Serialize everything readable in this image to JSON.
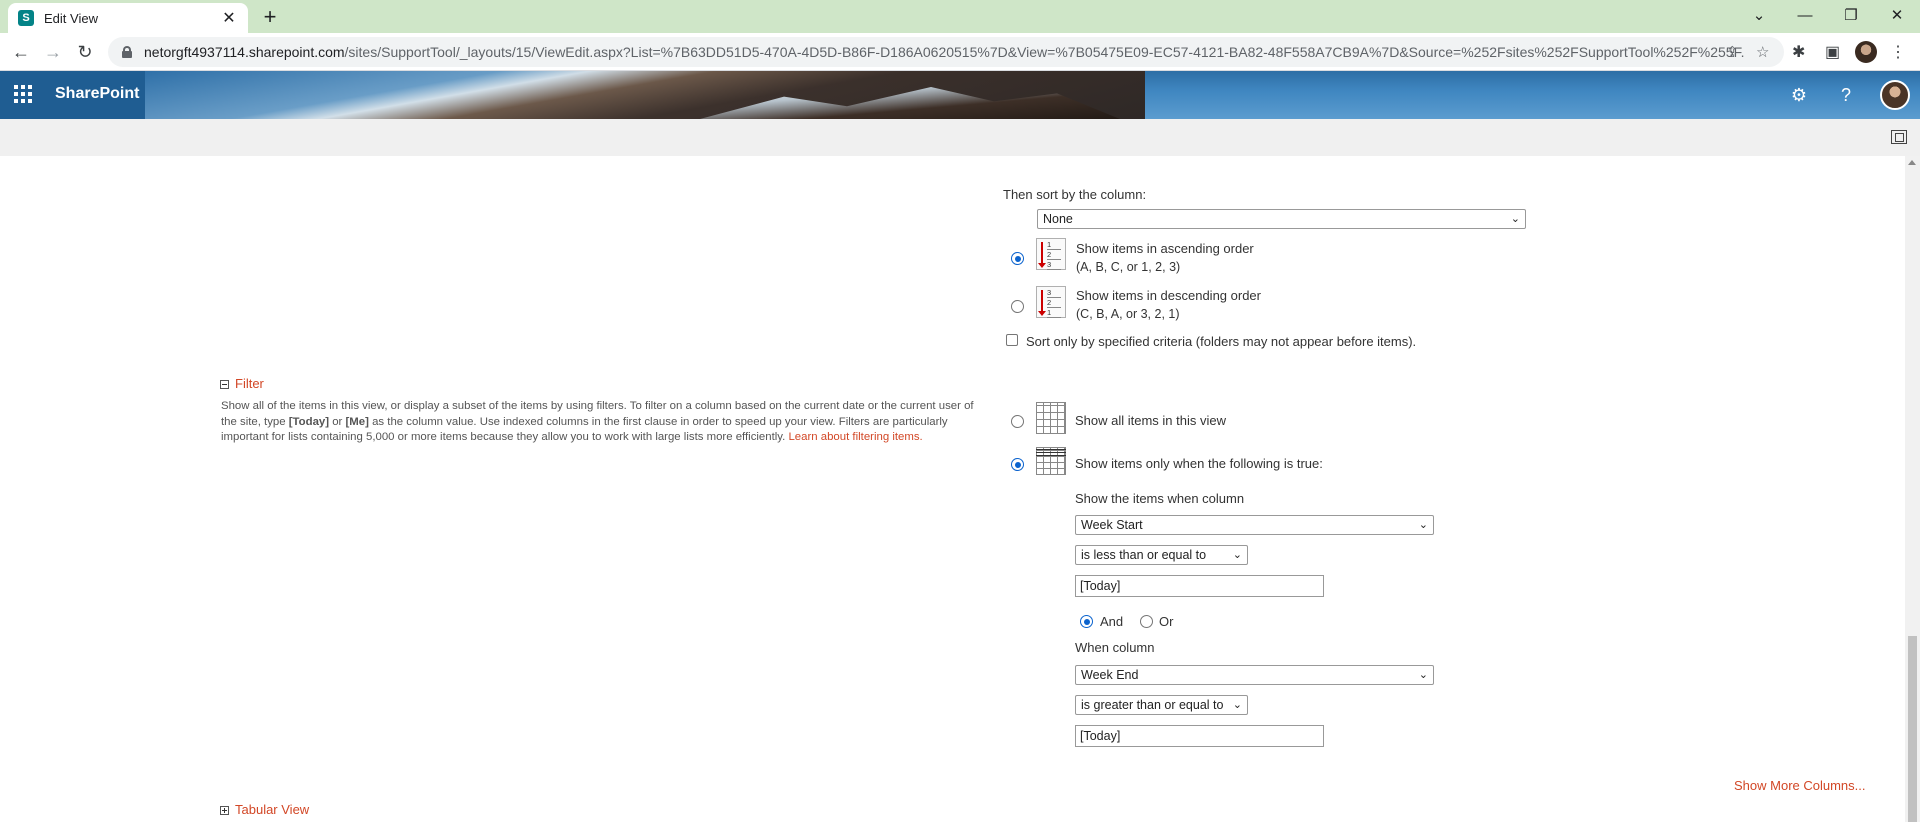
{
  "browser": {
    "tab_title": "Edit View",
    "favicon_letter": "S",
    "url_host": "netorgft4937114.sharepoint.com",
    "url_path": "/sites/SupportTool/_layouts/15/ViewEdit.aspx?List=%7B63DD51D5-470A-4D5D-B86F-D186A0620515%7D&View=%7B05475E09-EC57-4121-BA82-48F558A7CB9A%7D&Source=%252Fsites%252FSupportTool%252F%255F..."
  },
  "suite": {
    "app_name": "SharePoint"
  },
  "sort": {
    "then_sort_label": "Then sort by the column:",
    "column_value": "None",
    "ascending_label": "Show items in ascending order",
    "ascending_sub": "(A, B, C, or 1, 2, 3)",
    "descending_label": "Show items in descending order",
    "descending_sub": "(C, B, A, or 3, 2, 1)",
    "ascending_selected": true,
    "criteria_label": "Sort only by specified criteria (folders may not appear before items).",
    "asc_digits": [
      "1",
      "2",
      "3"
    ],
    "desc_digits": [
      "3",
      "2",
      "1"
    ]
  },
  "filter": {
    "title": "Filter",
    "desc_part1": "Show all of the items in this view, or display a subset of the items by using filters. To filter on a column based on the current date or the current user of the site, type ",
    "token_today": "[Today]",
    "desc_or": " or ",
    "token_me": "[Me]",
    "desc_part2": " as the column value. Use indexed columns in the first clause in order to speed up your view. Filters are particularly important for lists containing 5,000 or more items because they allow you to work with large lists more efficiently. ",
    "learn_link": "Learn about filtering items.",
    "show_all_label": "Show all items in this view",
    "show_when_label": "Show items only when the following is true:",
    "when_column_label": "Show the items when column",
    "column1": "Week Start",
    "operator1": "is less than or equal to",
    "value1": "[Today]",
    "and_label": "And",
    "or_label": "Or",
    "when_column2_label": "When column",
    "column2": "Week End",
    "operator2": "is greater than or equal to",
    "value2": "[Today]",
    "show_more": "Show More Columns..."
  },
  "tabular": {
    "title": "Tabular View"
  }
}
